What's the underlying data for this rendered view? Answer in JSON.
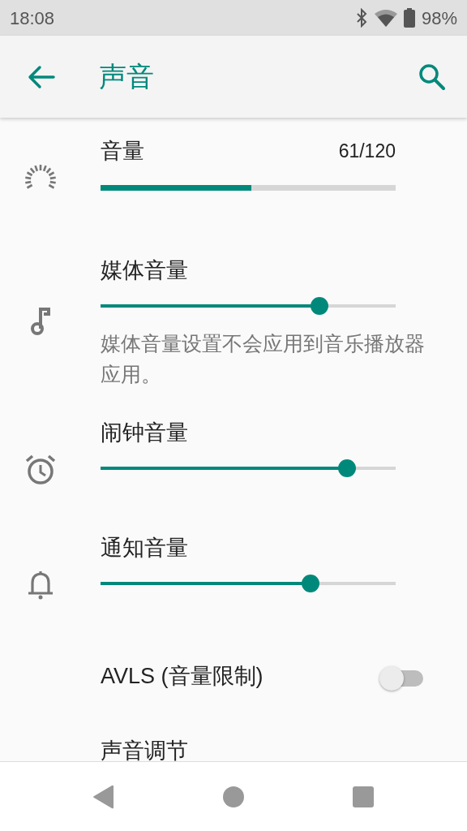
{
  "status_bar": {
    "time": "18:08",
    "battery": "98%"
  },
  "app_bar": {
    "title": "声音"
  },
  "settings": [
    {
      "kind": "progress",
      "title": "音量",
      "reading": "61/120",
      "level": 0.51
    },
    {
      "kind": "slider",
      "title": "媒体音量",
      "level": 0.742,
      "summary": "媒体音量设置不会应用到音乐播放器应用。"
    },
    {
      "kind": "slider",
      "title": "闹钟音量",
      "level": 0.835
    },
    {
      "kind": "slider",
      "title": "通知音量",
      "level": 0.711
    },
    {
      "kind": "switch",
      "title": "AVLS (音量限制)",
      "on": false
    },
    {
      "kind": "plain",
      "title": "声音调节"
    }
  ]
}
